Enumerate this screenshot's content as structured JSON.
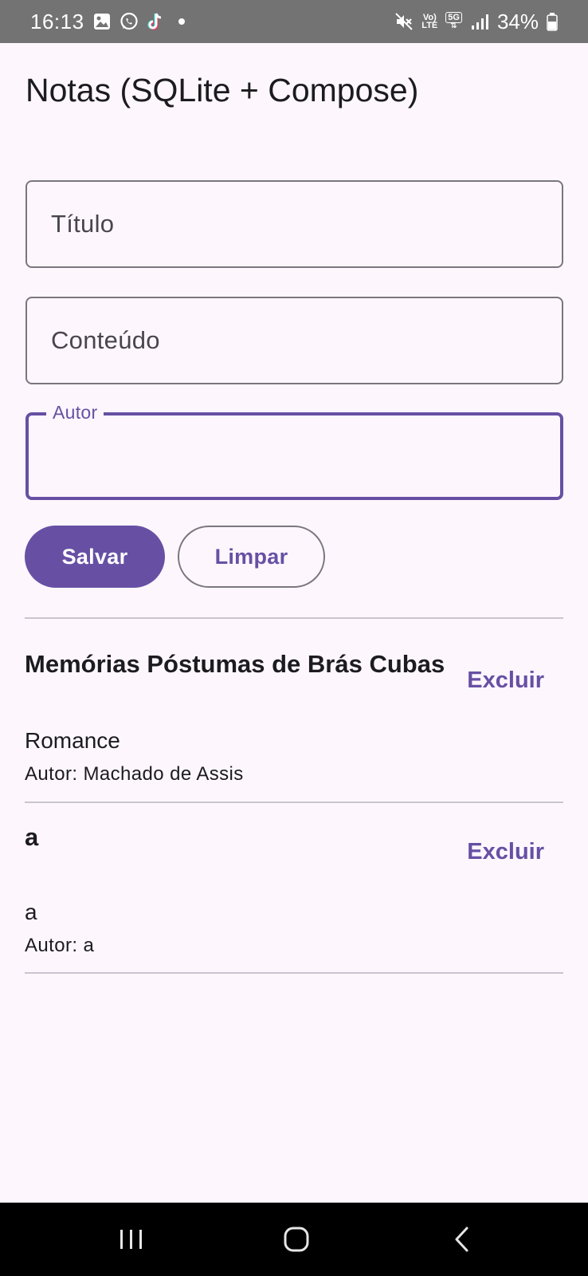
{
  "status_bar": {
    "time": "16:13",
    "battery": "34%",
    "left_icons": [
      "gallery-icon",
      "whatsapp-icon",
      "tiktok-icon",
      "dot"
    ],
    "right_icons": [
      "mute-icon",
      "volte-icon",
      "5g-icon",
      "signal-icon",
      "battery-icon"
    ],
    "volte_label_top": "Vo)",
    "volte_label_bottom": "LTE",
    "net_label": "5G"
  },
  "app": {
    "title": "Notas (SQLite + Compose)"
  },
  "form": {
    "title_placeholder": "Título",
    "content_placeholder": "Conteúdo",
    "author_label": "Autor",
    "author_value": "",
    "save_label": "Salvar",
    "clear_label": "Limpar"
  },
  "notes": [
    {
      "title": "Memórias Póstumas de Brás Cubas",
      "delete_label": "Excluir",
      "content": "Romance",
      "author": "Autor: Machado de Assis"
    },
    {
      "title": "a",
      "delete_label": "Excluir",
      "content": "a",
      "author": "Autor: a"
    }
  ],
  "colors": {
    "primary": "#6750a4",
    "background": "#fdf7fd",
    "outline": "#7a757f",
    "status_bar": "#737373"
  }
}
